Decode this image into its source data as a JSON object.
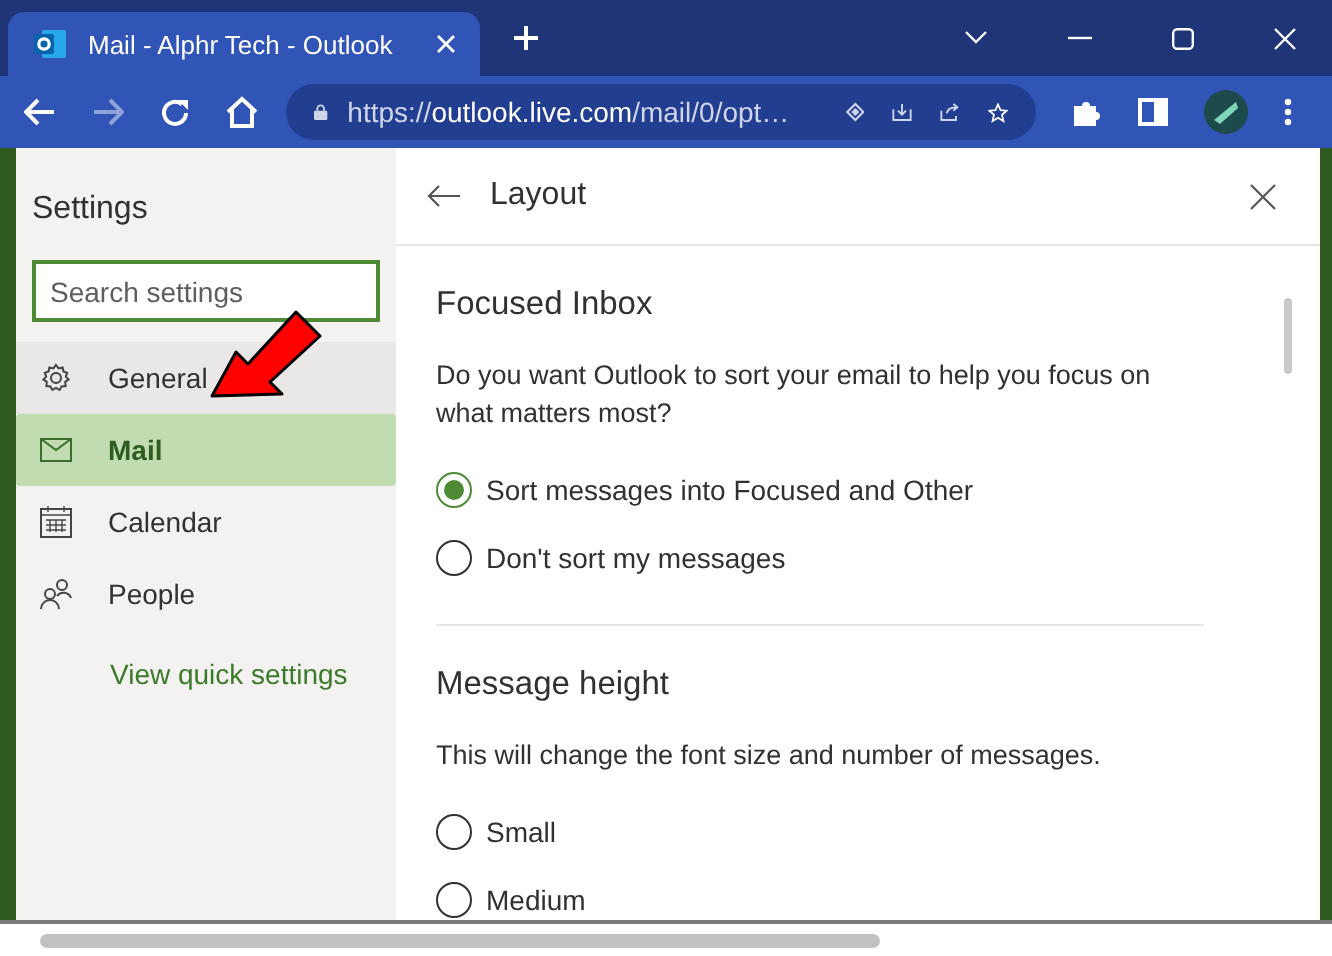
{
  "browser": {
    "tab_title": "Mail - Alphr Tech - Outlook",
    "url": "https://**outlook.live.com**/mail/0/opt…"
  },
  "settings": {
    "title": "Settings",
    "search": {
      "placeholder": "Search settings"
    },
    "nav": [
      {
        "label": "General",
        "selected": false,
        "kind": "gear"
      },
      {
        "label": "Mail",
        "selected": true,
        "kind": "mail"
      },
      {
        "label": "Calendar",
        "selected": false,
        "kind": "calendar"
      },
      {
        "label": "People",
        "selected": false,
        "kind": "people"
      }
    ],
    "link": "View quick settings"
  },
  "panel": {
    "title": "Layout",
    "sections": [
      {
        "heading": "Focused Inbox",
        "description": "Do you want Outlook to sort your email to help you focus on what matters most?",
        "options": [
          {
            "label": "Sort messages into Focused and Other",
            "selected": true
          },
          {
            "label": "Don't sort my messages",
            "selected": false
          }
        ]
      },
      {
        "heading": "Message height",
        "description": "This will change the font size and number of messages.",
        "options": [
          {
            "label": "Small",
            "selected": false
          },
          {
            "label": "Medium",
            "selected": false
          }
        ]
      }
    ]
  }
}
